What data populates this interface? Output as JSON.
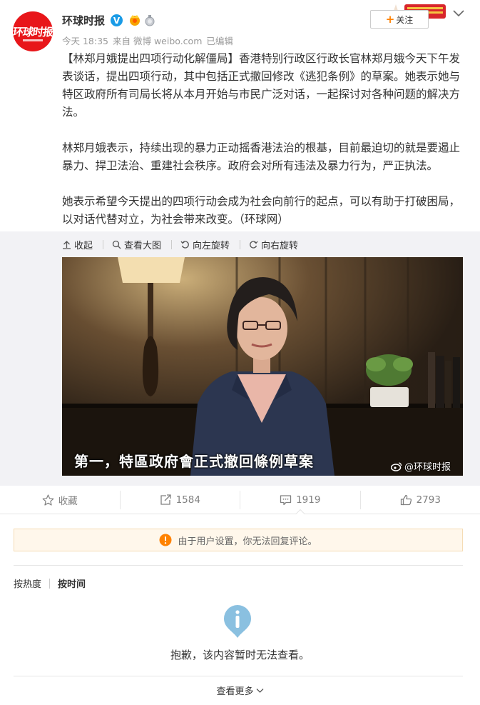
{
  "header": {
    "user_name": "环球时报",
    "avatar_logo_text": "环球时报",
    "verified_badge": "V",
    "meta": {
      "time": "今天 18:35",
      "source": "来自 微博 weibo.com",
      "edited": "已编辑"
    },
    "follow_label": "关注",
    "follow_plus": "+"
  },
  "post": {
    "paragraphs": [
      "【林郑月娥提出四项行动化解僵局】香港特别行政区行政长官林郑月娥今天下午发表谈话，提出四项行动，其中包括正式撤回修改《逃犯条例》的草案。她表示她与特区政府所有司局长将从本月开始与市民广泛对话，一起探讨对各种问题的解决方法。",
      "林郑月娥表示，持续出现的暴力正动摇香港法治的根基，目前最迫切的就是要遏止暴力、捍卫法治、重建社会秩序。政府会对所有违法及暴力行为，严正执法。",
      "她表示希望今天提出的四项行动会成为社会向前行的起点，可以有助于打破困局，以对话代替对立，为社会带来改变。（环球网）"
    ]
  },
  "media": {
    "tools": {
      "collapse": "收起",
      "view_large": "查看大图",
      "rotate_left": "向左旋转",
      "rotate_right": "向右旋转"
    },
    "caption": "第一，特區政府會正式撤回條例草案",
    "watermark": "@环球时报"
  },
  "actions": {
    "favorite": "收藏",
    "repost": "1584",
    "comment": "1919",
    "like": "2793"
  },
  "notice": "由于用户设置，你无法回复评论。",
  "sort": {
    "hot": "按热度",
    "time": "按时间"
  },
  "empty_message": "抱歉，该内容暂时无法查看。",
  "more_label": "查看更多",
  "colors": {
    "brand_red": "#e8161a",
    "verified_blue": "#1a9be6",
    "accent_orange": "#ff8200",
    "notice_bg": "#fff7eb",
    "info_blue": "#8ac0e0"
  },
  "icons": [
    "verified-icon",
    "vip-badge-icon",
    "medal-icon",
    "chevron-down-icon",
    "collapse-icon",
    "search-icon",
    "rotate-left-icon",
    "rotate-right-icon",
    "weibo-logo-icon",
    "star-icon",
    "repost-icon",
    "comment-icon",
    "thumbs-up-icon",
    "warning-icon",
    "info-icon"
  ]
}
